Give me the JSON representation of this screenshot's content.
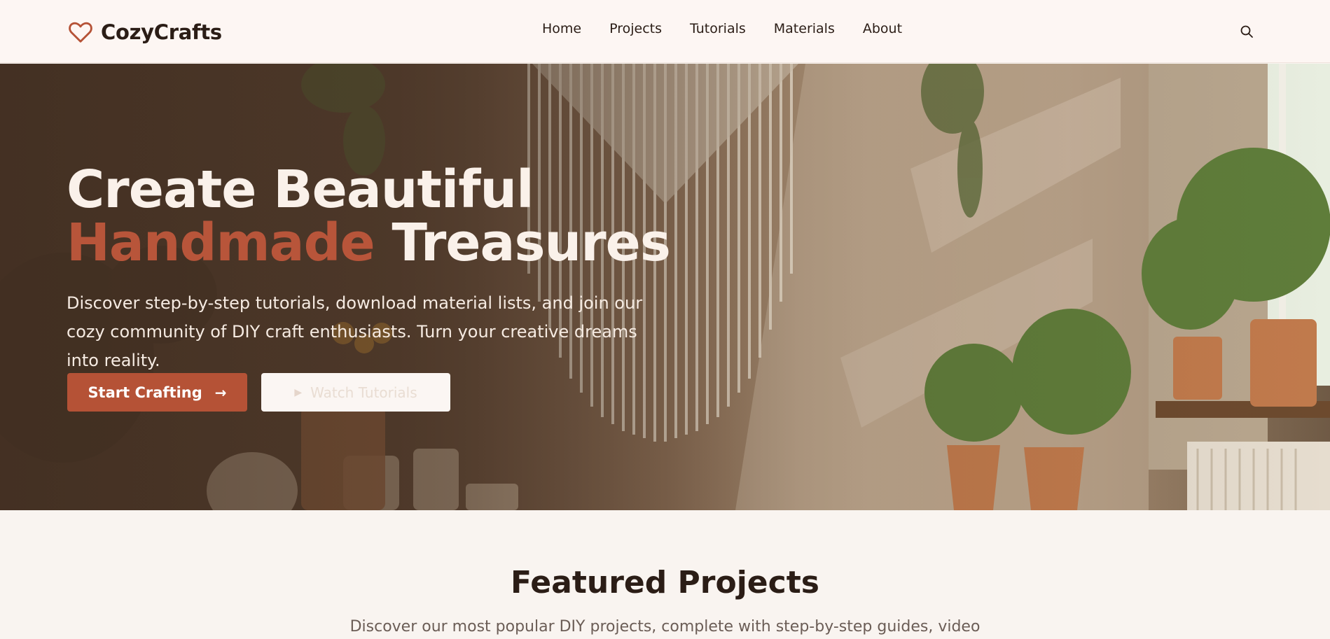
{
  "brand": {
    "name": "CozyCrafts",
    "logo_icon": "heart-outline-icon",
    "accent_color": "#b55236"
  },
  "nav": {
    "items": [
      "Home",
      "Projects",
      "Tutorials",
      "Materials",
      "About"
    ],
    "search_icon": "search-icon"
  },
  "hero": {
    "title_line1": "Create Beautiful",
    "title_accent": "Handmade",
    "title_rest": " Treasures",
    "subtitle": "Discover step-by-step tutorials, download material lists, and join our cozy community of DIY craft enthusiasts. Turn your creative dreams into reality.",
    "primary_cta": "Start Crafting",
    "secondary_cta": "Watch Tutorials"
  },
  "featured": {
    "title": "Featured Projects",
    "subtitle": "Discover our most popular DIY projects, complete with step-by-step guides, video"
  }
}
